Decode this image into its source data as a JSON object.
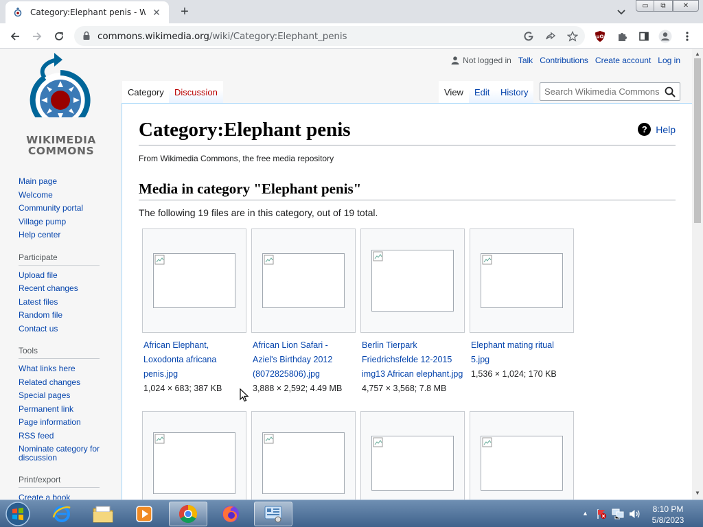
{
  "browser": {
    "tab_title": "Category:Elephant penis - Wikimedia Commons",
    "url_host": "commons.wikimedia.org",
    "url_path": "/wiki/Category:Elephant_penis",
    "window_controls": {
      "minimize": "▭",
      "maximize": "⧉",
      "close": "✕"
    }
  },
  "logo": {
    "line1": "WIKIMEDIA",
    "line2": "COMMONS"
  },
  "sidebar": {
    "main": [
      "Main page",
      "Welcome",
      "Community portal",
      "Village pump",
      "Help center"
    ],
    "participate_head": "Participate",
    "participate": [
      "Upload file",
      "Recent changes",
      "Latest files",
      "Random file",
      "Contact us"
    ],
    "tools_head": "Tools",
    "tools": [
      "What links here",
      "Related changes",
      "Special pages",
      "Permanent link",
      "Page information",
      "RSS feed"
    ],
    "nominate": "Nominate category for discussion",
    "print_head": "Print/export",
    "print": [
      "Create a book"
    ]
  },
  "personal": {
    "not_logged_in": "Not logged in",
    "talk": "Talk",
    "contributions": "Contributions",
    "create_account": "Create account",
    "log_in": "Log in"
  },
  "tabs": {
    "category": "Category",
    "discussion": "Discussion",
    "view": "View",
    "edit": "Edit",
    "history": "History"
  },
  "search": {
    "placeholder": "Search Wikimedia Commons"
  },
  "content": {
    "heading": "Category:Elephant penis",
    "help": "Help",
    "subtitle": "From Wikimedia Commons, the free media repository",
    "media_heading": "Media in category \"Elephant penis\"",
    "count_line": "The following 19 files are in this category, out of 19 total."
  },
  "gallery": [
    {
      "name": "African Elephant, Loxodonta africana penis.jpg",
      "meta": "1,024 × 683; 387 KB"
    },
    {
      "name": "African Lion Safari - Aziel's Birthday 2012 (8072825806).jpg",
      "meta": "3,888 × 2,592; 4.49 MB"
    },
    {
      "name": "Berlin Tierpark Friedrichsfelde 12-2015 img13 African elephant.jpg",
      "meta": "4,757 × 3,568; 7.8 MB"
    },
    {
      "name": "Elephant mating ritual 5.jpg",
      "meta": "1,536 × 1,024; 170 KB"
    },
    {
      "name": "",
      "meta": ""
    },
    {
      "name": "",
      "meta": ""
    },
    {
      "name": "",
      "meta": ""
    },
    {
      "name": "",
      "meta": ""
    }
  ],
  "taskbar": {
    "time": "8:10 PM",
    "date": "5/8/2023"
  }
}
